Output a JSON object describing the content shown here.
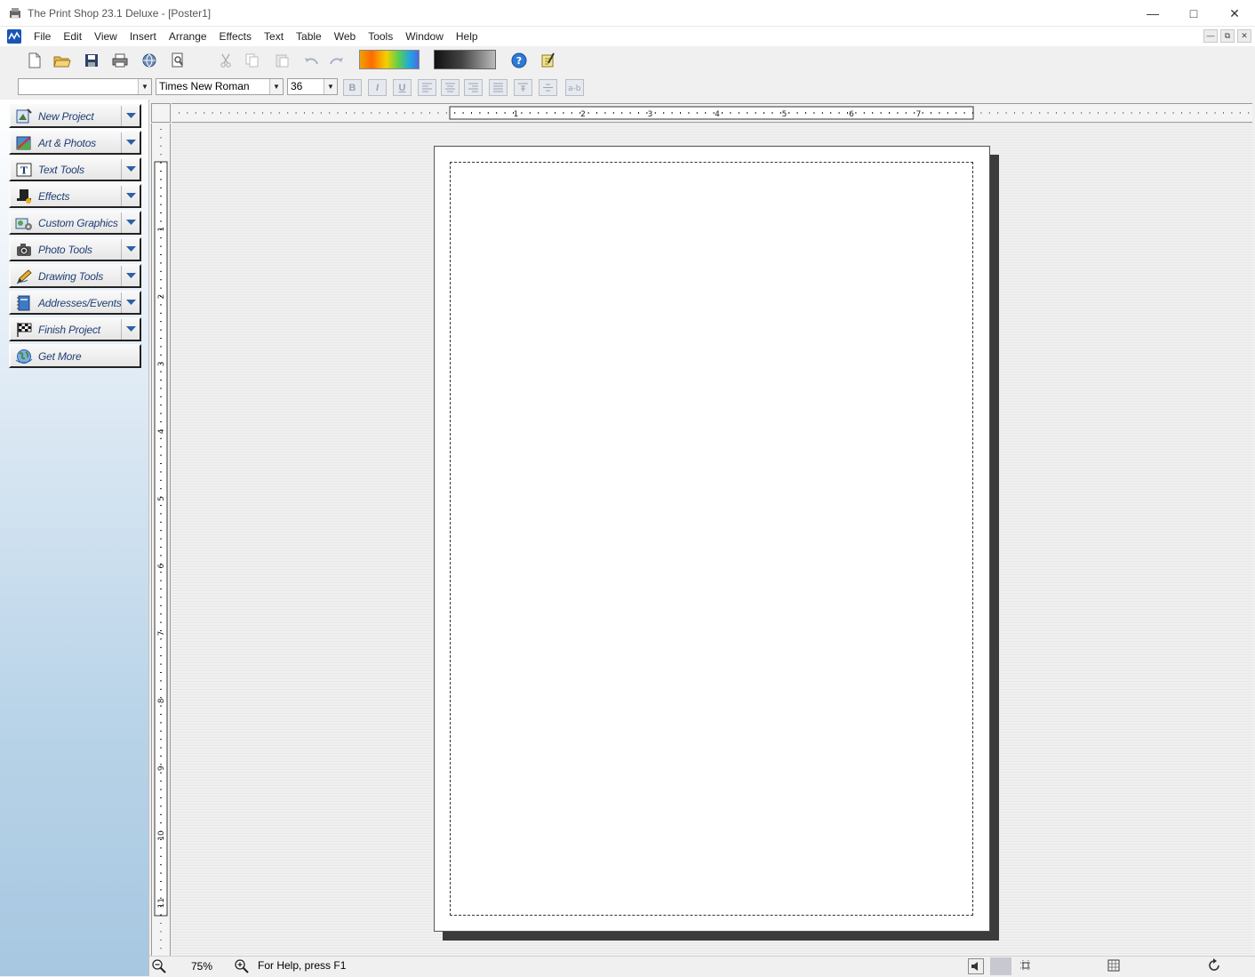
{
  "window": {
    "title": "The Print Shop 23.1 Deluxe - [Poster1]"
  },
  "menubar": {
    "items": [
      "File",
      "Edit",
      "View",
      "Insert",
      "Arrange",
      "Effects",
      "Text",
      "Table",
      "Web",
      "Tools",
      "Window",
      "Help"
    ]
  },
  "toolbar": {
    "icons": [
      "new-document-icon",
      "open-folder-icon",
      "save-icon",
      "print-icon",
      "web-globe-icon",
      "print-preview-icon",
      "cut-icon",
      "copy-icon",
      "paste-icon",
      "undo-icon",
      "redo-icon",
      "help-icon",
      "notepad-icon"
    ],
    "color_accent": "#f0a000",
    "gradient_dark": "#111111"
  },
  "format": {
    "style_value": "",
    "font_value": "Times New Roman",
    "size_value": "36",
    "buttons": [
      "B",
      "I",
      "U"
    ]
  },
  "sidebar": {
    "items": [
      {
        "label": "New Project",
        "icon": "new-project-icon"
      },
      {
        "label": "Art & Photos",
        "icon": "art-photos-icon"
      },
      {
        "label": "Text Tools",
        "icon": "text-tools-icon"
      },
      {
        "label": "Effects",
        "icon": "effects-hat-icon"
      },
      {
        "label": "Custom Graphics",
        "icon": "custom-graphics-icon"
      },
      {
        "label": "Photo Tools",
        "icon": "camera-icon"
      },
      {
        "label": "Drawing Tools",
        "icon": "pencil-icon"
      },
      {
        "label": "Addresses/Events",
        "icon": "address-book-icon"
      },
      {
        "label": "Finish Project",
        "icon": "checkered-flag-icon"
      },
      {
        "label": "Get More",
        "icon": "globe-icon"
      }
    ]
  },
  "rulers": {
    "horizontal_labels": [
      "1",
      "2",
      "3",
      "4",
      "5",
      "6",
      "7"
    ],
    "vertical_labels": [
      "1",
      "2",
      "3",
      "4",
      "5",
      "6",
      "7",
      "8",
      "9",
      "10",
      "11"
    ]
  },
  "status": {
    "zoom": "75%",
    "help_text": "For Help, press F1"
  }
}
